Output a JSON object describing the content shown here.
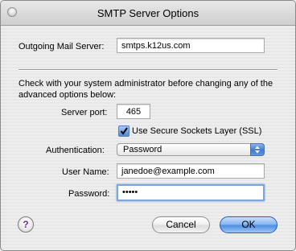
{
  "window": {
    "title": "SMTP Server Options"
  },
  "outgoing": {
    "label": "Outgoing Mail Server:",
    "value": "smtps.k12us.com"
  },
  "advanced": {
    "note": "Check with your system administrator before changing any of the advanced options below:"
  },
  "port": {
    "label": "Server port:",
    "value": "465"
  },
  "ssl": {
    "label": "Use Secure Sockets Layer (SSL)",
    "checked": true
  },
  "auth": {
    "label": "Authentication:",
    "value": "Password"
  },
  "username": {
    "label": "User Name:",
    "value": "janedoe@example.com"
  },
  "password": {
    "label": "Password:",
    "value": "•••••"
  },
  "buttons": {
    "help": "?",
    "cancel": "Cancel",
    "ok": "OK"
  }
}
